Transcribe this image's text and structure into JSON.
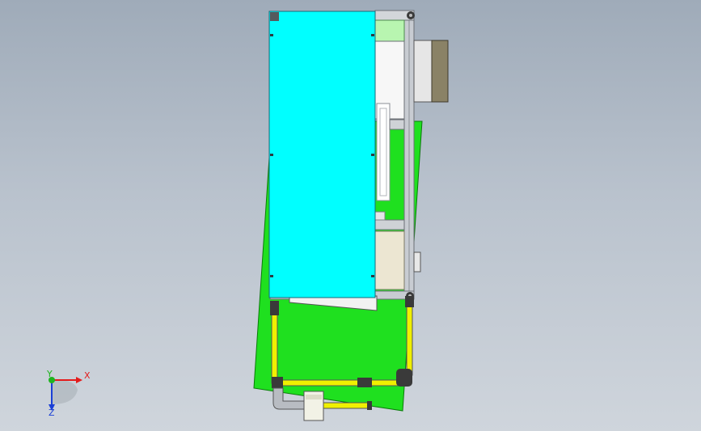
{
  "viewport": {
    "background_top": "#9fabb9",
    "background_bottom": "#cfd5dc"
  },
  "colors": {
    "cyan_panel": "#00ffff",
    "green_plate": "#1fe01f",
    "light_green": "#b8f5b0",
    "yellow_tube": "#f0f000",
    "tan_panel": "#ece6d2",
    "brown_box": "#8a8266",
    "frame_gray": "#c8ccd2",
    "dark_fitting": "#3a3a3a",
    "axis_x": "#e41b1b",
    "axis_y": "#1fb41f",
    "axis_z": "#1a3fd6"
  },
  "triad": {
    "x_label": "X",
    "y_label": "Y",
    "z_label": "Z",
    "icon": "coordinate-triad-icon"
  }
}
